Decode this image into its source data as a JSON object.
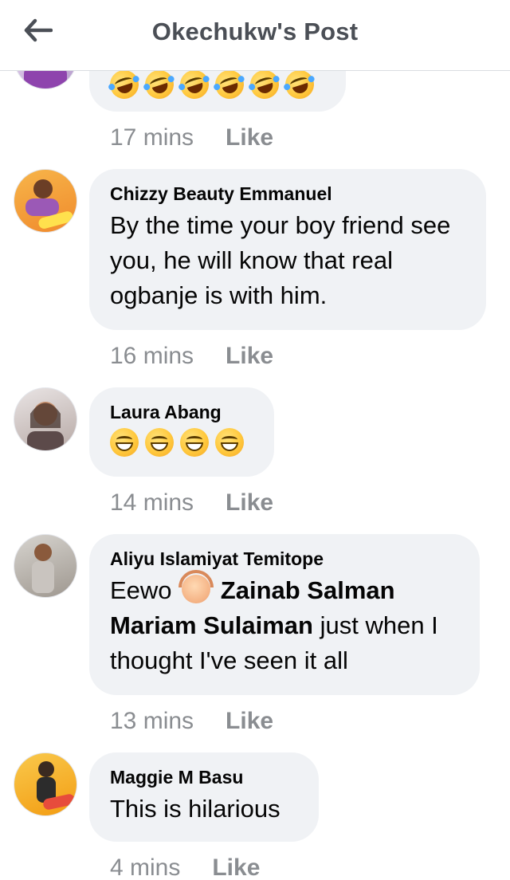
{
  "header": {
    "title": "Okechukw's Post",
    "back_icon": "arrow-left-icon"
  },
  "colors": {
    "bubble_bg": "#f0f2f5",
    "meta_text": "#8a8d91",
    "title_text": "#4b4f56"
  },
  "comments": [
    {
      "author": "",
      "text": "",
      "emojis": [
        "rolling-laughing",
        "rolling-laughing",
        "rolling-laughing",
        "rolling-laughing",
        "rolling-laughing",
        "rolling-laughing"
      ],
      "time": "17 mins",
      "like_label": "Like"
    },
    {
      "author": "Chizzy Beauty Emmanuel",
      "text": "By the time your boy friend see you, he will know that real ogbanje is with him.",
      "time": "16 mins",
      "like_label": "Like"
    },
    {
      "author": "Laura Abang",
      "emojis": [
        "grinning-squint",
        "grinning-squint",
        "grinning-squint",
        "grinning-squint"
      ],
      "time": "14 mins",
      "like_label": "Like"
    },
    {
      "author": "Aliyu Islamiyat Temitope",
      "text_prefix": "Eewo",
      "inline_emoji": "woman-gesturing-ok",
      "mention_1": "Zainab Salman",
      "mention_2": "Mariam Sulaiman",
      "text_suffix": "just when I thought I've seen it all",
      "time": "13 mins",
      "like_label": "Like"
    },
    {
      "author": "Maggie M Basu",
      "text": "This is hilarious",
      "time": "4 mins",
      "like_label": "Like"
    }
  ]
}
